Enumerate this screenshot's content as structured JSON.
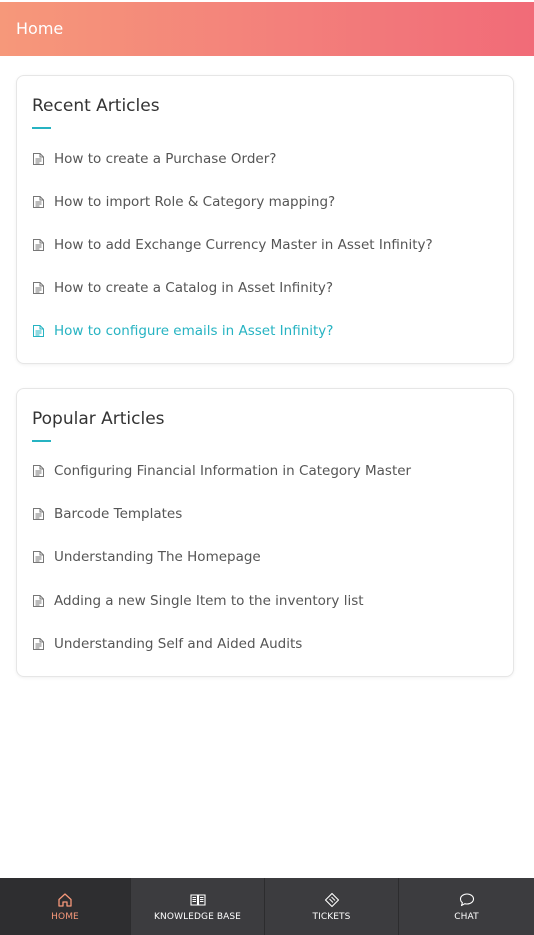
{
  "header": {
    "title": "Home"
  },
  "recent": {
    "title": "Recent Articles",
    "articles": [
      {
        "label": "How to create a Purchase Order?"
      },
      {
        "label": "How to import Role & Category mapping?"
      },
      {
        "label": "How to add Exchange Currency Master in Asset Infinity?"
      },
      {
        "label": "How to create a Catalog in Asset Infinity?"
      },
      {
        "label": "How to configure emails in Asset Infinity?"
      }
    ]
  },
  "popular": {
    "title": "Popular Articles",
    "articles": [
      {
        "label": "Configuring Financial Information in Category Master"
      },
      {
        "label": "Barcode Templates"
      },
      {
        "label": "Understanding The Homepage"
      },
      {
        "label": "Adding a new Single Item to the inventory list"
      },
      {
        "label": "Understanding Self and Aided Audits"
      }
    ]
  },
  "nav": {
    "items": [
      {
        "label": "HOME",
        "icon": "home-icon"
      },
      {
        "label": "KNOWLEDGE BASE",
        "icon": "book-icon"
      },
      {
        "label": "TICKETS",
        "icon": "ticket-icon"
      },
      {
        "label": "CHAT",
        "icon": "chat-icon"
      }
    ]
  },
  "colors": {
    "header_start": "#f6987a",
    "header_end": "#f16b78",
    "accent": "#26b3c2",
    "nav_bg": "#3c3c3f",
    "nav_active_label": "#f6987a"
  }
}
